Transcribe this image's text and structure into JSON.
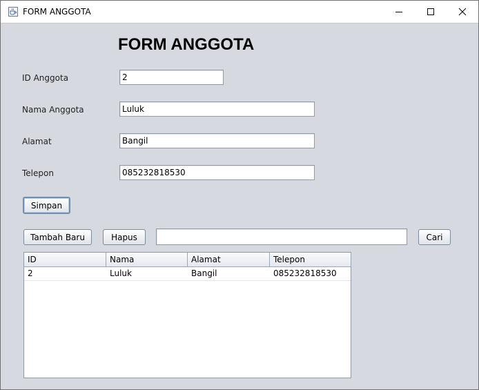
{
  "window": {
    "title": "FORM ANGGOTA"
  },
  "form": {
    "heading": "FORM ANGGOTA",
    "id_label": "ID Anggota",
    "id_value": "2",
    "nama_label": "Nama Anggota",
    "nama_value": "Luluk",
    "alamat_label": "Alamat",
    "alamat_value": "Bangil",
    "telepon_label": "Telepon",
    "telepon_value": "085232818530",
    "simpan_label": "Simpan"
  },
  "toolbar": {
    "tambah_label": "Tambah Baru",
    "hapus_label": "Hapus",
    "search_value": "",
    "cari_label": "Cari"
  },
  "table": {
    "columns": [
      "ID",
      "Nama",
      "Alamat",
      "Telepon"
    ],
    "rows": [
      [
        "2",
        "Luluk",
        "Bangil",
        "085232818530"
      ]
    ]
  },
  "icons": {
    "app": "java-cup-icon",
    "minimize": "minimize-icon",
    "maximize": "maximize-icon",
    "close": "close-icon"
  }
}
